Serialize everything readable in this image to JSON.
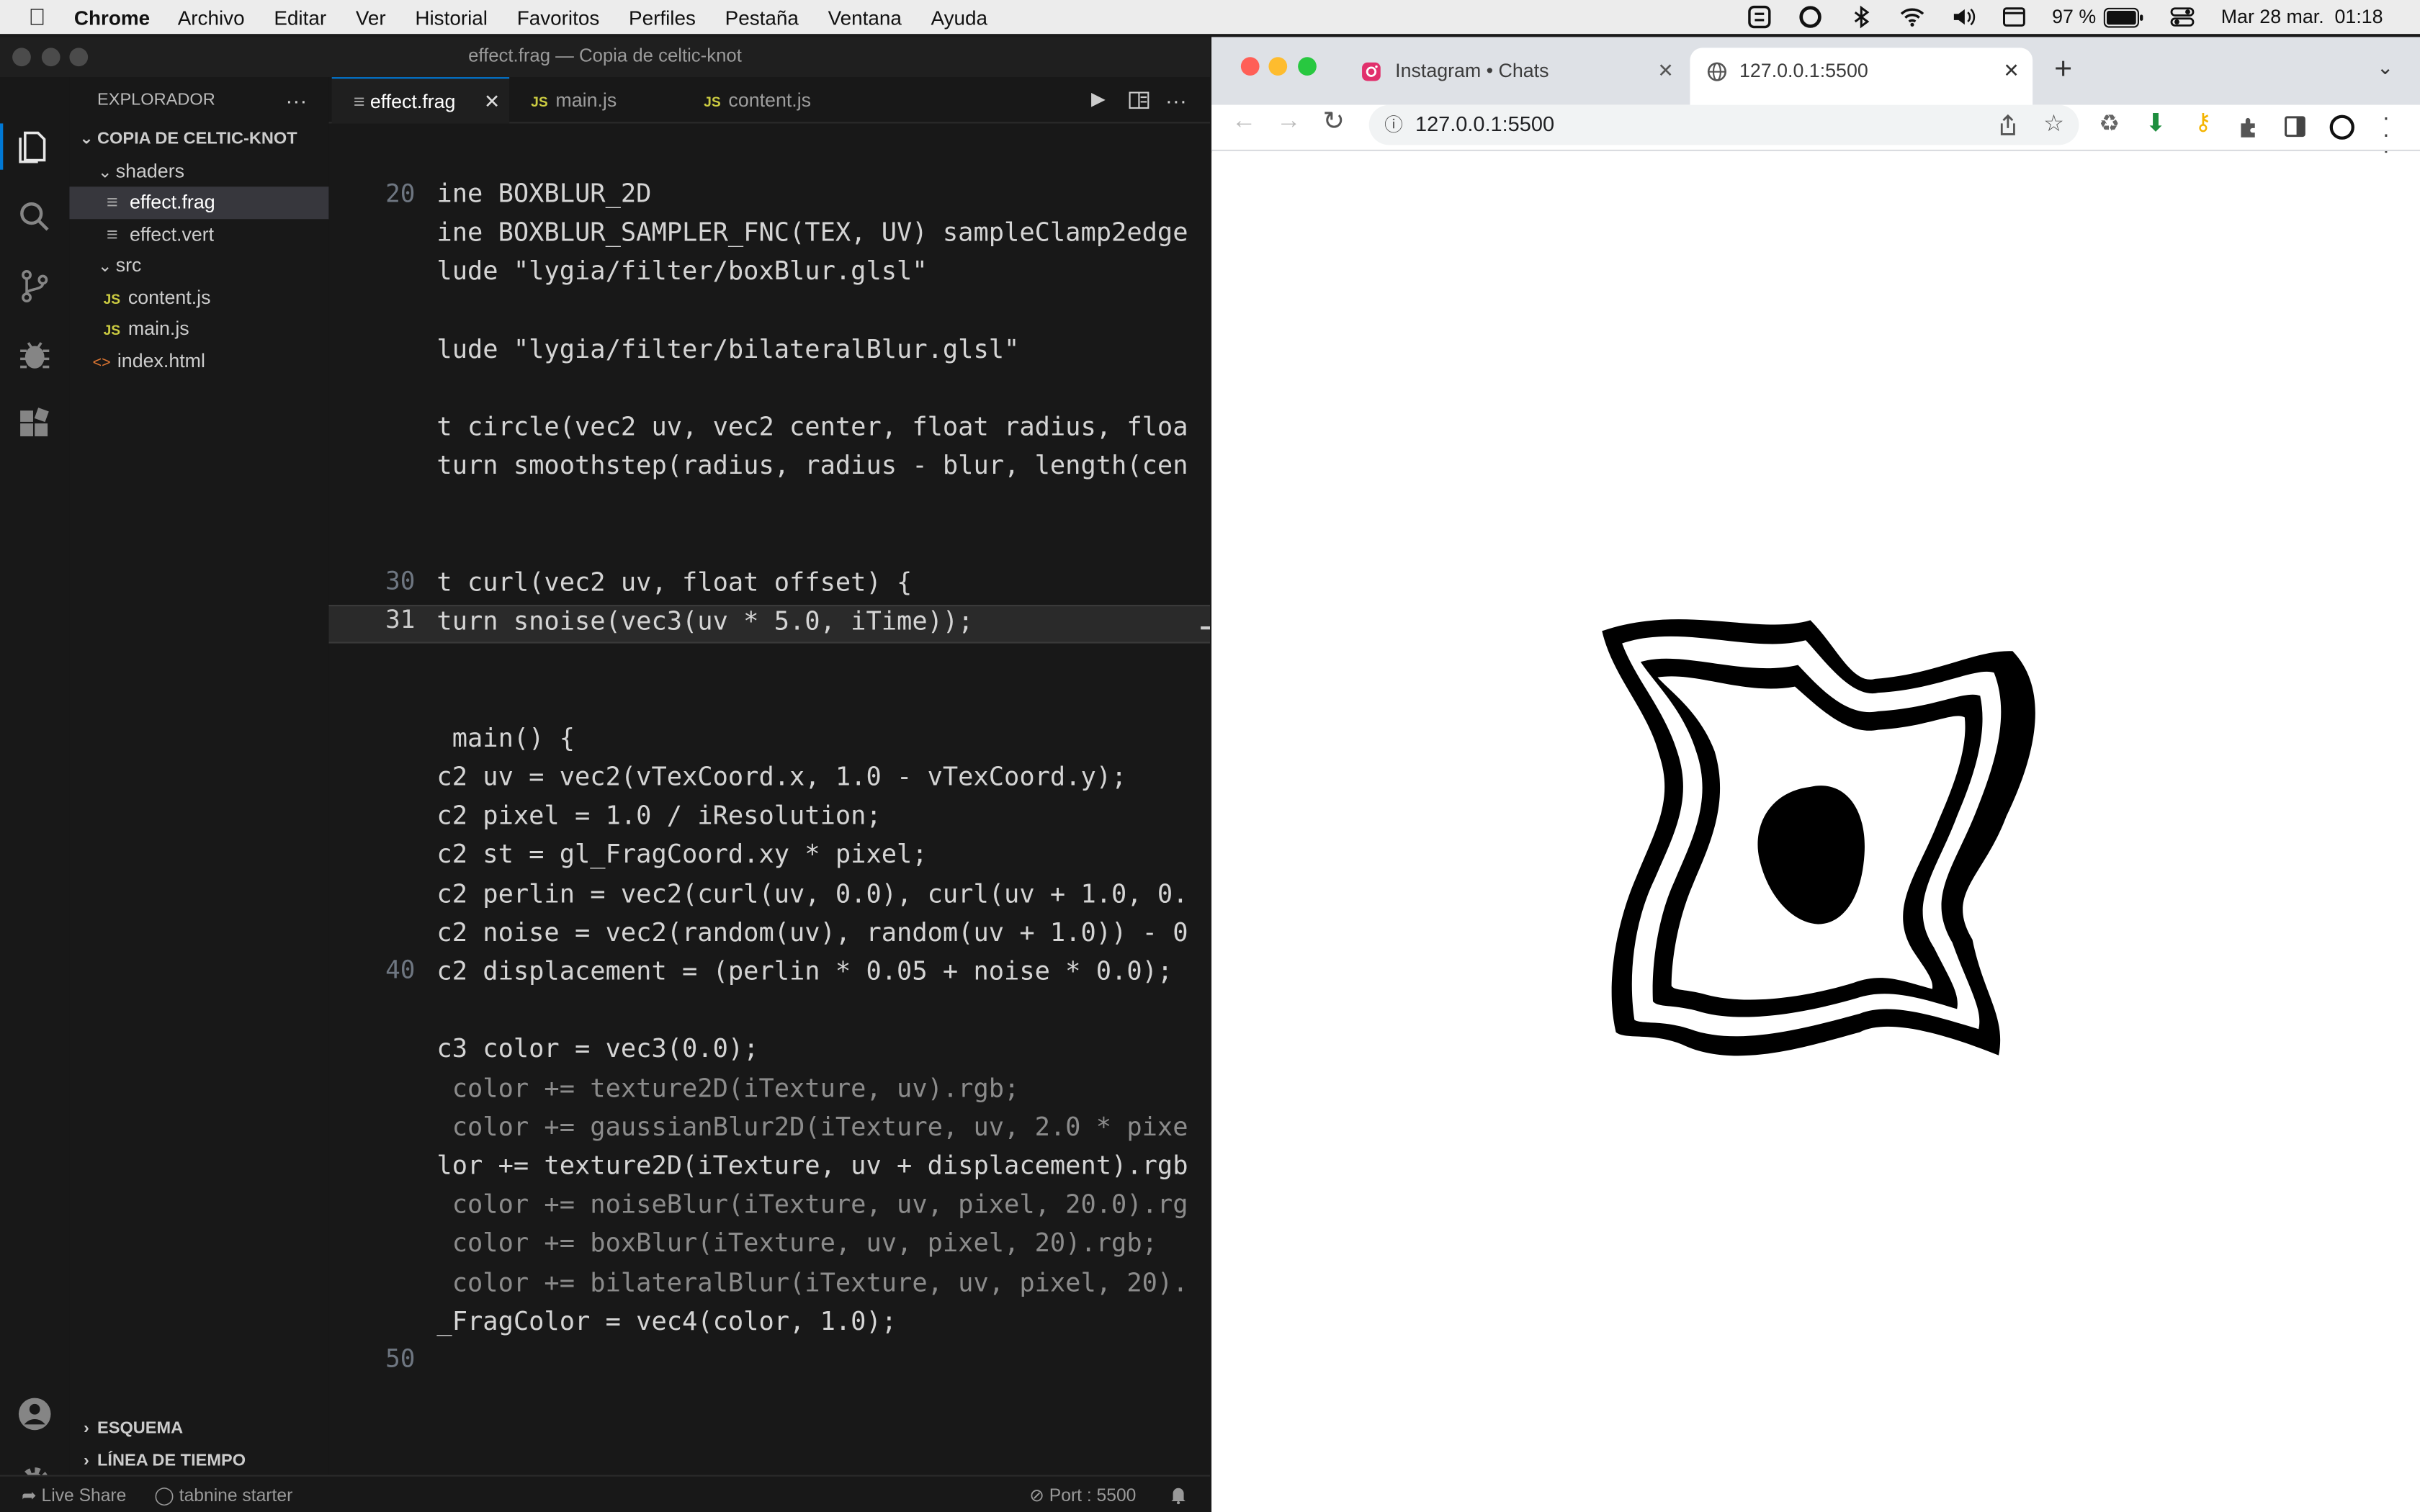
{
  "menubar": {
    "app": "Chrome",
    "items": [
      "Archivo",
      "Editar",
      "Ver",
      "Historial",
      "Favoritos",
      "Perfiles",
      "Pestaña",
      "Ventana",
      "Ayuda"
    ],
    "battery": "97 %",
    "datetime": "Mar 28 mar.  01:18"
  },
  "vscode": {
    "title": "effect.frag — Copia de celtic-knot",
    "explorer_title": "EXPLORADOR",
    "project": "COPIA DE CELTIC-KNOT",
    "tree": [
      {
        "label": "shaders",
        "type": "folder"
      },
      {
        "label": "effect.frag",
        "type": "file"
      },
      {
        "label": "effect.vert",
        "type": "file"
      },
      {
        "label": "src",
        "type": "folder"
      },
      {
        "label": "content.js",
        "type": "js"
      },
      {
        "label": "main.js",
        "type": "js"
      },
      {
        "label": "index.html",
        "type": "html"
      }
    ],
    "js_badge": "JS",
    "tabs": [
      "effect.frag",
      "main.js",
      "content.js"
    ],
    "outline": "ESQUEMA",
    "timeline": "LÍNEA DE TIEMPO",
    "status": {
      "live_share": "Live Share",
      "tabnine": "tabnine starter",
      "port": "Port : 5500"
    },
    "line_numbers": {
      "l20": "20",
      "l30": "30",
      "l31": "31",
      "l40": "40",
      "l50": "50"
    },
    "code": [
      "ine BOXBLUR_2D",
      "ine BOXBLUR_SAMPLER_FNC(TEX, UV) sampleClamp2edge",
      "lude \"lygia/filter/boxBlur.glsl\"",
      "",
      "lude \"lygia/filter/bilateralBlur.glsl\"",
      "",
      "t circle(vec2 uv, vec2 center, float radius, floa",
      "turn smoothstep(radius, radius - blur, length(cen",
      "",
      "",
      "t curl(vec2 uv, float offset) {",
      "turn snoise(vec3(uv * 5.0, iTime));",
      "",
      "",
      " main() {",
      "c2 uv = vec2(vTexCoord.x, 1.0 - vTexCoord.y);",
      "c2 pixel = 1.0 / iResolution;",
      "c2 st = gl_FragCoord.xy * pixel;",
      "c2 perlin = vec2(curl(uv, 0.0), curl(uv + 1.0, 0.",
      "c2 noise = vec2(random(uv), random(uv + 1.0)) - 0",
      "c2 displacement = (perlin * 0.05 + noise * 0.0);",
      "",
      "c3 color = vec3(0.0);",
      " color += texture2D(iTexture, uv).rgb;",
      " color += gaussianBlur2D(iTexture, uv, 2.0 * pixe",
      "lor += texture2D(iTexture, uv + displacement).rgb",
      " color += noiseBlur(iTexture, uv, pixel, 20.0).rg",
      " color += boxBlur(iTexture, uv, pixel, 20).rgb;",
      " color += bilateralBlur(iTexture, uv, pixel, 20).",
      "_FragColor = vec4(color, 1.0);"
    ]
  },
  "chrome": {
    "tabs": [
      {
        "title": "Instagram • Chats"
      },
      {
        "title": "127.0.0.1:5500"
      }
    ],
    "url": "127.0.0.1:5500"
  }
}
